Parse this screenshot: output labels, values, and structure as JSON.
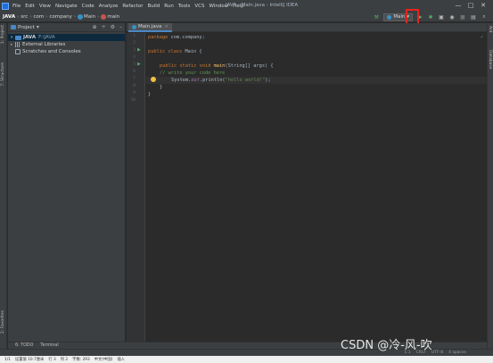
{
  "window": {
    "title": "JAVA - Main.java - IntelliJ IDEA",
    "controls": [
      "—",
      "□",
      "✕"
    ]
  },
  "menu": [
    "File",
    "Edit",
    "View",
    "Navigate",
    "Code",
    "Analyze",
    "Refactor",
    "Build",
    "Run",
    "Tools",
    "VCS",
    "Window",
    "Help"
  ],
  "breadcrumb": [
    "JAVA",
    "src",
    "com",
    "company",
    "Main",
    "main"
  ],
  "toolbar": {
    "run_config": "Main",
    "run_icon": "play-icon",
    "highlight_color": "#e8231f"
  },
  "project_panel": {
    "title": "Project",
    "tree": [
      {
        "label": "JAVA",
        "path": "F:\\JAVA",
        "expanded": true
      },
      {
        "label": "External Libraries",
        "expanded": false
      },
      {
        "label": "Scratches and Consoles",
        "expanded": false
      }
    ]
  },
  "left_tabs": [
    "1: Project",
    "7: Structure",
    "2: Favorites"
  ],
  "right_tabs": [
    "Ant",
    "Database"
  ],
  "editor": {
    "tab_label": "Main.java",
    "line_numbers": [
      "1",
      "2",
      "3",
      "4",
      "5",
      "6",
      "7",
      "8",
      "9",
      "10"
    ],
    "code": {
      "line1_kw": "package",
      "line1_rest": " com.company;",
      "line3_kw": "public class",
      "line3_rest": " Main {",
      "line5_kw": "public static void",
      "line5_fn": "main",
      "line5_rest": "(String[] args) {",
      "line6_comment": "// write your code here",
      "line7_a": "System.",
      "line7_field": "out",
      "line7_b": ".println(",
      "line7_str": "\"hello world!\"",
      "line7_c": ");",
      "line8": "}",
      "line9": "}"
    }
  },
  "bottom_tabs": [
    "6: TODO",
    "Terminal"
  ],
  "status": [
    "1:1",
    "CRLF",
    "UTF-8",
    "4 spaces"
  ],
  "taskbar": [
    "1/1",
    "设置值 10.7厘米",
    "行 3",
    "列 2",
    "字数: 293",
    "中文(中国)",
    "插入"
  ],
  "watermark": "CSDN @冷-风-吹"
}
